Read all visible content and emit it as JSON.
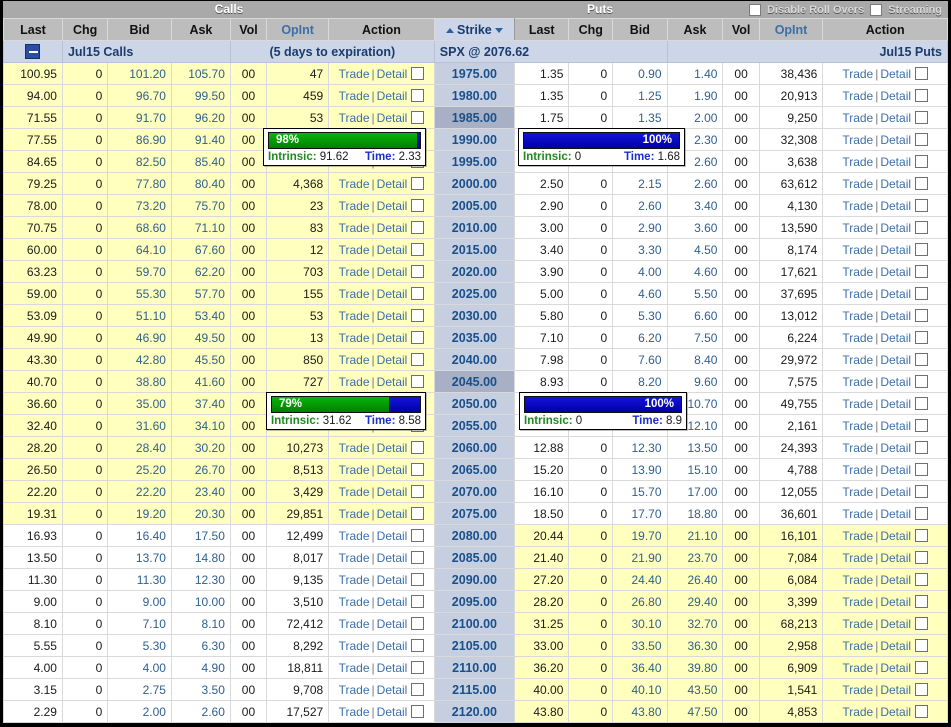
{
  "banner": {
    "calls_label": "Calls",
    "puts_label": "Puts",
    "disable_rollovers_label": "Disable Roll Overs",
    "streaming_label": "Streaming"
  },
  "columns": {
    "last": "Last",
    "chg": "Chg",
    "bid": "Bid",
    "ask": "Ask",
    "vol": "Vol",
    "opint": "OpInt",
    "action": "Action",
    "strike": "Strike"
  },
  "expiration_row": {
    "calls_title": "Jul15 Calls",
    "days": "(5 days to expiration)",
    "underlying": "SPX @ 2076.62",
    "puts_title": "Jul15 Puts"
  },
  "action": {
    "trade": "Trade",
    "separator": "|",
    "detail": "Detail"
  },
  "colors": {
    "itm_background": "#ffffbe",
    "otm_background": "#ffffff",
    "strike_background": "#c6cfe0",
    "strike_highlight": "#a7b0c4",
    "link": "#3c6fa8",
    "intrinsic_green": "#1f8b1f",
    "time_blue": "#1a2fd0",
    "bar_blue": "#0000a8",
    "bar_green": "#008000"
  },
  "tooltips": [
    {
      "id": "call-tooltip",
      "percent_text": "98%",
      "percent_value": 98,
      "fill_color": "green",
      "align": "left",
      "intrinsic_label": "Intrinsic:",
      "intrinsic_value": "91.62",
      "time_label": "Time:",
      "time_value": "2.33"
    },
    {
      "id": "put-tooltip-upper",
      "percent_text": "100%",
      "percent_value": 100,
      "fill_color": "blue",
      "align": "right",
      "intrinsic_label": "Intrinsic:",
      "intrinsic_value": "0",
      "time_label": "Time:",
      "time_value": "1.68"
    },
    {
      "id": "call-tooltip-lower",
      "percent_text": "79%",
      "percent_value": 79,
      "fill_color": "green",
      "align": "left",
      "intrinsic_label": "Intrinsic:",
      "intrinsic_value": "31.62",
      "time_label": "Time:",
      "time_value": "8.58"
    },
    {
      "id": "put-tooltip-lower",
      "percent_text": "100%",
      "percent_value": 100,
      "fill_color": "blue",
      "align": "right",
      "intrinsic_label": "Intrinsic:",
      "intrinsic_value": "0",
      "time_label": "Time:",
      "time_value": "8.9"
    }
  ],
  "rows": [
    {
      "strike": "1975.00",
      "highlight": false,
      "itm_calls": true,
      "call": {
        "last": "100.95",
        "chg": "0",
        "bid": "101.20",
        "ask": "105.70",
        "vol": "00",
        "opint": "47"
      },
      "put": {
        "last": "1.35",
        "chg": "0",
        "bid": "0.90",
        "ask": "1.40",
        "vol": "00",
        "opint": "38,436"
      }
    },
    {
      "strike": "1980.00",
      "highlight": false,
      "itm_calls": true,
      "call": {
        "last": "94.00",
        "chg": "0",
        "bid": "96.70",
        "ask": "99.50",
        "vol": "00",
        "opint": "459"
      },
      "put": {
        "last": "1.35",
        "chg": "0",
        "bid": "1.25",
        "ask": "1.90",
        "vol": "00",
        "opint": "20,913"
      }
    },
    {
      "strike": "1985.00",
      "highlight": true,
      "itm_calls": true,
      "call": {
        "last": "71.55",
        "chg": "0",
        "bid": "91.70",
        "ask": "96.20",
        "vol": "00",
        "opint": "53"
      },
      "put": {
        "last": "1.75",
        "chg": "0",
        "bid": "1.35",
        "ask": "2.00",
        "vol": "00",
        "opint": "9,250"
      }
    },
    {
      "strike": "1990.00",
      "highlight": false,
      "itm_calls": true,
      "call": {
        "last": "77.55",
        "chg": "0",
        "bid": "86.90",
        "ask": "91.40",
        "vol": "00",
        "opint": ""
      },
      "put": {
        "last": "",
        "chg": "",
        "bid": "",
        "ask": "2.30",
        "vol": "00",
        "opint": "32,308"
      }
    },
    {
      "strike": "1995.00",
      "highlight": false,
      "itm_calls": true,
      "call": {
        "last": "84.65",
        "chg": "0",
        "bid": "82.50",
        "ask": "85.40",
        "vol": "00",
        "opint": ""
      },
      "put": {
        "last": "",
        "chg": "",
        "bid": "",
        "ask": "2.60",
        "vol": "00",
        "opint": "3,638"
      }
    },
    {
      "strike": "2000.00",
      "highlight": false,
      "itm_calls": true,
      "call": {
        "last": "79.25",
        "chg": "0",
        "bid": "77.80",
        "ask": "80.40",
        "vol": "00",
        "opint": "4,368"
      },
      "put": {
        "last": "2.50",
        "chg": "0",
        "bid": "2.15",
        "ask": "2.60",
        "vol": "00",
        "opint": "63,612"
      }
    },
    {
      "strike": "2005.00",
      "highlight": false,
      "itm_calls": true,
      "call": {
        "last": "78.00",
        "chg": "0",
        "bid": "73.20",
        "ask": "75.70",
        "vol": "00",
        "opint": "23"
      },
      "put": {
        "last": "2.90",
        "chg": "0",
        "bid": "2.60",
        "ask": "3.40",
        "vol": "00",
        "opint": "4,130"
      }
    },
    {
      "strike": "2010.00",
      "highlight": false,
      "itm_calls": true,
      "call": {
        "last": "70.75",
        "chg": "0",
        "bid": "68.60",
        "ask": "71.10",
        "vol": "00",
        "opint": "83"
      },
      "put": {
        "last": "3.00",
        "chg": "0",
        "bid": "2.90",
        "ask": "3.60",
        "vol": "00",
        "opint": "13,590"
      }
    },
    {
      "strike": "2015.00",
      "highlight": false,
      "itm_calls": true,
      "call": {
        "last": "60.00",
        "chg": "0",
        "bid": "64.10",
        "ask": "67.60",
        "vol": "00",
        "opint": "12"
      },
      "put": {
        "last": "3.40",
        "chg": "0",
        "bid": "3.30",
        "ask": "4.50",
        "vol": "00",
        "opint": "8,174"
      }
    },
    {
      "strike": "2020.00",
      "highlight": false,
      "itm_calls": true,
      "call": {
        "last": "63.23",
        "chg": "0",
        "bid": "59.70",
        "ask": "62.20",
        "vol": "00",
        "opint": "703"
      },
      "put": {
        "last": "3.90",
        "chg": "0",
        "bid": "4.00",
        "ask": "4.60",
        "vol": "00",
        "opint": "17,621"
      }
    },
    {
      "strike": "2025.00",
      "highlight": false,
      "itm_calls": true,
      "call": {
        "last": "59.00",
        "chg": "0",
        "bid": "55.30",
        "ask": "57.70",
        "vol": "00",
        "opint": "155"
      },
      "put": {
        "last": "5.00",
        "chg": "0",
        "bid": "4.60",
        "ask": "5.50",
        "vol": "00",
        "opint": "37,695"
      }
    },
    {
      "strike": "2030.00",
      "highlight": false,
      "itm_calls": true,
      "call": {
        "last": "53.09",
        "chg": "0",
        "bid": "51.10",
        "ask": "53.40",
        "vol": "00",
        "opint": "53"
      },
      "put": {
        "last": "5.80",
        "chg": "0",
        "bid": "5.30",
        "ask": "6.60",
        "vol": "00",
        "opint": "13,012"
      }
    },
    {
      "strike": "2035.00",
      "highlight": false,
      "itm_calls": true,
      "call": {
        "last": "49.90",
        "chg": "0",
        "bid": "46.90",
        "ask": "49.50",
        "vol": "00",
        "opint": "13"
      },
      "put": {
        "last": "7.10",
        "chg": "0",
        "bid": "6.20",
        "ask": "7.50",
        "vol": "00",
        "opint": "6,224"
      }
    },
    {
      "strike": "2040.00",
      "highlight": false,
      "itm_calls": true,
      "call": {
        "last": "43.30",
        "chg": "0",
        "bid": "42.80",
        "ask": "45.50",
        "vol": "00",
        "opint": "850"
      },
      "put": {
        "last": "7.98",
        "chg": "0",
        "bid": "7.60",
        "ask": "8.40",
        "vol": "00",
        "opint": "29,972"
      }
    },
    {
      "strike": "2045.00",
      "highlight": true,
      "itm_calls": true,
      "call": {
        "last": "40.70",
        "chg": "0",
        "bid": "38.80",
        "ask": "41.60",
        "vol": "00",
        "opint": "727"
      },
      "put": {
        "last": "8.93",
        "chg": "0",
        "bid": "8.20",
        "ask": "9.60",
        "vol": "00",
        "opint": "7,575"
      }
    },
    {
      "strike": "2050.00",
      "highlight": false,
      "itm_calls": true,
      "call": {
        "last": "36.60",
        "chg": "0",
        "bid": "35.00",
        "ask": "37.40",
        "vol": "00",
        "opint": ""
      },
      "put": {
        "last": "",
        "chg": "",
        "bid": "",
        "ask": "10.70",
        "vol": "00",
        "opint": "49,755"
      }
    },
    {
      "strike": "2055.00",
      "highlight": false,
      "itm_calls": true,
      "call": {
        "last": "32.40",
        "chg": "0",
        "bid": "31.60",
        "ask": "34.10",
        "vol": "00",
        "opint": ""
      },
      "put": {
        "last": "",
        "chg": "",
        "bid": "",
        "ask": "12.10",
        "vol": "00",
        "opint": "2,161"
      }
    },
    {
      "strike": "2060.00",
      "highlight": false,
      "itm_calls": true,
      "call": {
        "last": "28.20",
        "chg": "0",
        "bid": "28.40",
        "ask": "30.20",
        "vol": "00",
        "opint": "10,273"
      },
      "put": {
        "last": "12.88",
        "chg": "0",
        "bid": "12.30",
        "ask": "13.50",
        "vol": "00",
        "opint": "24,393"
      }
    },
    {
      "strike": "2065.00",
      "highlight": false,
      "itm_calls": true,
      "call": {
        "last": "26.50",
        "chg": "0",
        "bid": "25.20",
        "ask": "26.70",
        "vol": "00",
        "opint": "8,513"
      },
      "put": {
        "last": "15.20",
        "chg": "0",
        "bid": "13.90",
        "ask": "15.10",
        "vol": "00",
        "opint": "4,788"
      }
    },
    {
      "strike": "2070.00",
      "highlight": false,
      "itm_calls": true,
      "call": {
        "last": "22.20",
        "chg": "0",
        "bid": "22.20",
        "ask": "23.40",
        "vol": "00",
        "opint": "3,429"
      },
      "put": {
        "last": "16.10",
        "chg": "0",
        "bid": "15.70",
        "ask": "17.00",
        "vol": "00",
        "opint": "12,055"
      }
    },
    {
      "strike": "2075.00",
      "highlight": false,
      "itm_calls": true,
      "call": {
        "last": "19.31",
        "chg": "0",
        "bid": "19.20",
        "ask": "20.30",
        "vol": "00",
        "opint": "29,851"
      },
      "put": {
        "last": "18.50",
        "chg": "0",
        "bid": "17.70",
        "ask": "18.80",
        "vol": "00",
        "opint": "36,601"
      }
    },
    {
      "strike": "2080.00",
      "highlight": false,
      "itm_calls": false,
      "call": {
        "last": "16.93",
        "chg": "0",
        "bid": "16.40",
        "ask": "17.50",
        "vol": "00",
        "opint": "12,499"
      },
      "put": {
        "last": "20.44",
        "chg": "0",
        "bid": "19.70",
        "ask": "21.10",
        "vol": "00",
        "opint": "16,101"
      }
    },
    {
      "strike": "2085.00",
      "highlight": false,
      "itm_calls": false,
      "call": {
        "last": "13.50",
        "chg": "0",
        "bid": "13.70",
        "ask": "14.80",
        "vol": "00",
        "opint": "8,017"
      },
      "put": {
        "last": "21.40",
        "chg": "0",
        "bid": "21.90",
        "ask": "23.70",
        "vol": "00",
        "opint": "7,084"
      }
    },
    {
      "strike": "2090.00",
      "highlight": false,
      "itm_calls": false,
      "call": {
        "last": "11.30",
        "chg": "0",
        "bid": "11.30",
        "ask": "12.30",
        "vol": "00",
        "opint": "9,135"
      },
      "put": {
        "last": "27.20",
        "chg": "0",
        "bid": "24.40",
        "ask": "26.40",
        "vol": "00",
        "opint": "6,084"
      }
    },
    {
      "strike": "2095.00",
      "highlight": false,
      "itm_calls": false,
      "call": {
        "last": "9.00",
        "chg": "0",
        "bid": "9.00",
        "ask": "10.00",
        "vol": "00",
        "opint": "3,510"
      },
      "put": {
        "last": "28.20",
        "chg": "0",
        "bid": "26.80",
        "ask": "29.40",
        "vol": "00",
        "opint": "3,399"
      }
    },
    {
      "strike": "2100.00",
      "highlight": false,
      "itm_calls": false,
      "call": {
        "last": "8.10",
        "chg": "0",
        "bid": "7.10",
        "ask": "8.10",
        "vol": "00",
        "opint": "72,412"
      },
      "put": {
        "last": "31.25",
        "chg": "0",
        "bid": "30.10",
        "ask": "32.70",
        "vol": "00",
        "opint": "68,213"
      }
    },
    {
      "strike": "2105.00",
      "highlight": false,
      "itm_calls": false,
      "call": {
        "last": "5.55",
        "chg": "0",
        "bid": "5.30",
        "ask": "6.30",
        "vol": "00",
        "opint": "8,292"
      },
      "put": {
        "last": "33.00",
        "chg": "0",
        "bid": "33.50",
        "ask": "36.30",
        "vol": "00",
        "opint": "2,958"
      }
    },
    {
      "strike": "2110.00",
      "highlight": false,
      "itm_calls": false,
      "call": {
        "last": "4.00",
        "chg": "0",
        "bid": "4.00",
        "ask": "4.90",
        "vol": "00",
        "opint": "18,811"
      },
      "put": {
        "last": "36.20",
        "chg": "0",
        "bid": "36.40",
        "ask": "39.80",
        "vol": "00",
        "opint": "6,909"
      }
    },
    {
      "strike": "2115.00",
      "highlight": false,
      "itm_calls": false,
      "call": {
        "last": "3.15",
        "chg": "0",
        "bid": "2.75",
        "ask": "3.50",
        "vol": "00",
        "opint": "9,708"
      },
      "put": {
        "last": "40.00",
        "chg": "0",
        "bid": "40.10",
        "ask": "43.50",
        "vol": "00",
        "opint": "1,541"
      }
    },
    {
      "strike": "2120.00",
      "highlight": false,
      "itm_calls": false,
      "call": {
        "last": "2.29",
        "chg": "0",
        "bid": "2.00",
        "ask": "2.60",
        "vol": "00",
        "opint": "17,527"
      },
      "put": {
        "last": "43.80",
        "chg": "0",
        "bid": "43.80",
        "ask": "47.50",
        "vol": "00",
        "opint": "4,853"
      }
    }
  ]
}
